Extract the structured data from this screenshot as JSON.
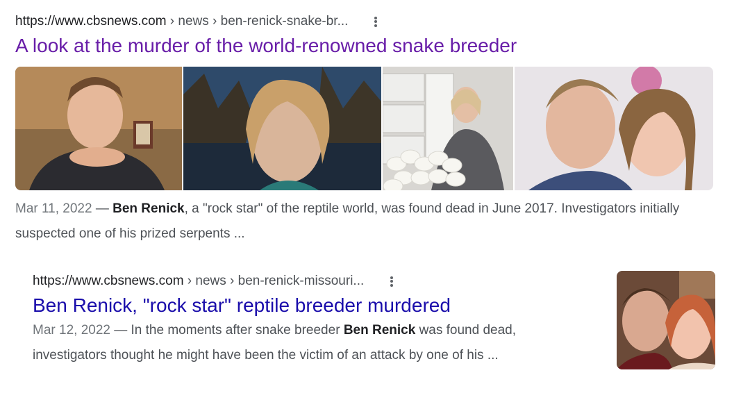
{
  "results": [
    {
      "url": "https://www.cbsnews.com",
      "breadcrumb": " › news › ben-renick-snake-br...",
      "title": "A look at the murder of the world-renowned snake breeder",
      "snippet_date": "Mar 11, 2022",
      "snippet_sep": " — ",
      "snippet_bold": "Ben Renick",
      "snippet_rest": ", a \"rock star\" of the reptile world, was found dead in June 2017. Investigators initially suspected one of his prized serpents ..."
    },
    {
      "url": "https://www.cbsnews.com",
      "breadcrumb": " › news › ben-renick-missouri...",
      "title": "Ben Renick, \"rock star\" reptile breeder murdered",
      "snippet_date": "Mar 12, 2022",
      "snippet_sep": " — In the moments after snake breeder ",
      "snippet_bold": "Ben Renick",
      "snippet_rest": " was found dead, investigators thought he might have been the victim of an attack by one of his ..."
    }
  ],
  "colors": {
    "visited_link": "#681da8",
    "link": "#1a0dab",
    "text": "#4d5156"
  },
  "icons": [
    "more-vert-icon"
  ]
}
